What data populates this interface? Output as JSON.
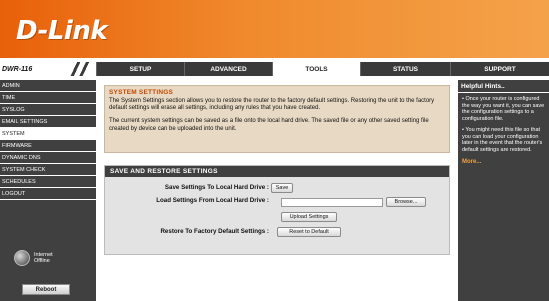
{
  "banner": {
    "logo_text": "D-Link"
  },
  "navbar": {
    "model": "DWR-116",
    "tabs": [
      {
        "label": "SETUP"
      },
      {
        "label": "ADVANCED"
      },
      {
        "label": "TOOLS"
      },
      {
        "label": "STATUS"
      },
      {
        "label": "SUPPORT"
      }
    ],
    "active_tab": "TOOLS"
  },
  "sidebar": {
    "items": [
      {
        "label": "ADMIN"
      },
      {
        "label": "TIME"
      },
      {
        "label": "SYSLOG"
      },
      {
        "label": "EMAIL SETTINGS"
      },
      {
        "label": "SYSTEM"
      },
      {
        "label": "FIRMWARE"
      },
      {
        "label": "DYNAMIC DNS"
      },
      {
        "label": "SYSTEM CHECK"
      },
      {
        "label": "SCHEDULES"
      },
      {
        "label": "LOGOUT"
      }
    ],
    "active_item": "SYSTEM",
    "internet_label_1": "Internet",
    "internet_label_2": "Offline",
    "reboot_label": "Reboot"
  },
  "main": {
    "intro": {
      "title": "SYSTEM SETTINGS",
      "paragraph_1": "The System Settings section allows you to restore the router to the factory default settings. Restoring the unit to the factory default settings will erase all settings, including any rules that you have created.",
      "paragraph_2": "The current system settings can be saved as a file onto the local hard drive. The saved file or any other saved setting file created by device can be uploaded into the unit."
    },
    "save_restore": {
      "title": "SAVE AND RESTORE SETTINGS",
      "save_label": "Save Settings To Local Hard Drive :",
      "save_button": "Save",
      "load_label": "Load Settings From Local Hard Drive :",
      "browse_button": "Browse...",
      "upload_button": "Upload Settings",
      "restore_label": "Restore To Factory Default Settings :",
      "reset_button": "Reset to Default"
    }
  },
  "hints": {
    "title": "Helpful Hints..",
    "items": [
      "• Once your router is configured the way you want it, you can save the configuration settings to a configuration file.",
      "• You might need this file so that you can load your configuration later in the event that the router's default settings are restored."
    ],
    "more": "More..."
  },
  "colors": {
    "banner_orange": "#e8600a",
    "nav_dark": "#3a3a3a",
    "panel_tan": "#e8d9c4",
    "heading_orange": "#c04a00",
    "more_link": "#f0a040"
  }
}
